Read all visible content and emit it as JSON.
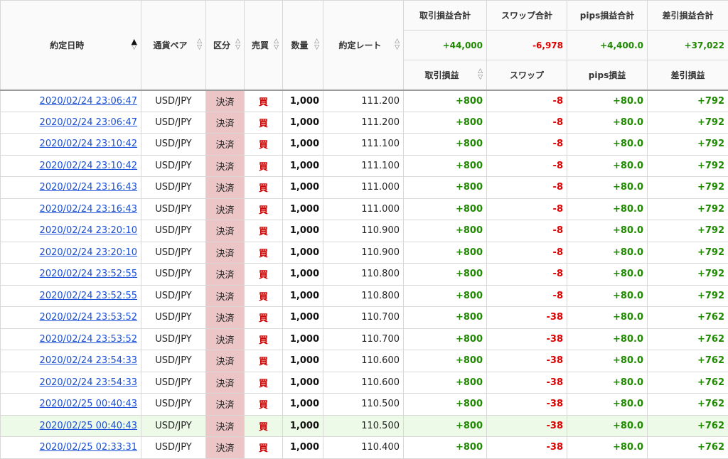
{
  "headers": {
    "datetime": "約定日時",
    "pair": "通貨ペア",
    "kind": "区分",
    "side": "売買",
    "qty": "数量",
    "rate": "約定レート",
    "pl_total": "取引損益合計",
    "swap_total": "スワップ合計",
    "pips_total": "pips損益合計",
    "net_total": "差引損益合計",
    "pl": "取引損益",
    "swap": "スワップ",
    "pips": "pips損益",
    "net": "差引損益"
  },
  "sort_glyphs": {
    "up": "△",
    "down": "▽",
    "up_active": "▲"
  },
  "totals": {
    "pl": "+44,000",
    "swap": "-6,978",
    "pips": "+4,400.0",
    "net": "+37,022"
  },
  "colors": {
    "positive": "#1f8a00",
    "negative": "#e00000",
    "kind_bg": "#ecc6c6",
    "highlight_row": "#eefae8",
    "link": "#1a4fd6"
  },
  "rows": [
    {
      "dt": "2020/02/24 23:06:47",
      "pair": "USD/JPY",
      "kind": "決済",
      "side": "買",
      "qty": "1,000",
      "rate": "111.200",
      "pl": "+800",
      "swap": "-8",
      "pips": "+80.0",
      "net": "+792"
    },
    {
      "dt": "2020/02/24 23:06:47",
      "pair": "USD/JPY",
      "kind": "決済",
      "side": "買",
      "qty": "1,000",
      "rate": "111.200",
      "pl": "+800",
      "swap": "-8",
      "pips": "+80.0",
      "net": "+792"
    },
    {
      "dt": "2020/02/24 23:10:42",
      "pair": "USD/JPY",
      "kind": "決済",
      "side": "買",
      "qty": "1,000",
      "rate": "111.100",
      "pl": "+800",
      "swap": "-8",
      "pips": "+80.0",
      "net": "+792"
    },
    {
      "dt": "2020/02/24 23:10:42",
      "pair": "USD/JPY",
      "kind": "決済",
      "side": "買",
      "qty": "1,000",
      "rate": "111.100",
      "pl": "+800",
      "swap": "-8",
      "pips": "+80.0",
      "net": "+792"
    },
    {
      "dt": "2020/02/24 23:16:43",
      "pair": "USD/JPY",
      "kind": "決済",
      "side": "買",
      "qty": "1,000",
      "rate": "111.000",
      "pl": "+800",
      "swap": "-8",
      "pips": "+80.0",
      "net": "+792"
    },
    {
      "dt": "2020/02/24 23:16:43",
      "pair": "USD/JPY",
      "kind": "決済",
      "side": "買",
      "qty": "1,000",
      "rate": "111.000",
      "pl": "+800",
      "swap": "-8",
      "pips": "+80.0",
      "net": "+792"
    },
    {
      "dt": "2020/02/24 23:20:10",
      "pair": "USD/JPY",
      "kind": "決済",
      "side": "買",
      "qty": "1,000",
      "rate": "110.900",
      "pl": "+800",
      "swap": "-8",
      "pips": "+80.0",
      "net": "+792"
    },
    {
      "dt": "2020/02/24 23:20:10",
      "pair": "USD/JPY",
      "kind": "決済",
      "side": "買",
      "qty": "1,000",
      "rate": "110.900",
      "pl": "+800",
      "swap": "-8",
      "pips": "+80.0",
      "net": "+792"
    },
    {
      "dt": "2020/02/24 23:52:55",
      "pair": "USD/JPY",
      "kind": "決済",
      "side": "買",
      "qty": "1,000",
      "rate": "110.800",
      "pl": "+800",
      "swap": "-8",
      "pips": "+80.0",
      "net": "+792"
    },
    {
      "dt": "2020/02/24 23:52:55",
      "pair": "USD/JPY",
      "kind": "決済",
      "side": "買",
      "qty": "1,000",
      "rate": "110.800",
      "pl": "+800",
      "swap": "-8",
      "pips": "+80.0",
      "net": "+792"
    },
    {
      "dt": "2020/02/24 23:53:52",
      "pair": "USD/JPY",
      "kind": "決済",
      "side": "買",
      "qty": "1,000",
      "rate": "110.700",
      "pl": "+800",
      "swap": "-38",
      "pips": "+80.0",
      "net": "+762"
    },
    {
      "dt": "2020/02/24 23:53:52",
      "pair": "USD/JPY",
      "kind": "決済",
      "side": "買",
      "qty": "1,000",
      "rate": "110.700",
      "pl": "+800",
      "swap": "-38",
      "pips": "+80.0",
      "net": "+762"
    },
    {
      "dt": "2020/02/24 23:54:33",
      "pair": "USD/JPY",
      "kind": "決済",
      "side": "買",
      "qty": "1,000",
      "rate": "110.600",
      "pl": "+800",
      "swap": "-38",
      "pips": "+80.0",
      "net": "+762"
    },
    {
      "dt": "2020/02/24 23:54:33",
      "pair": "USD/JPY",
      "kind": "決済",
      "side": "買",
      "qty": "1,000",
      "rate": "110.600",
      "pl": "+800",
      "swap": "-38",
      "pips": "+80.0",
      "net": "+762"
    },
    {
      "dt": "2020/02/25 00:40:43",
      "pair": "USD/JPY",
      "kind": "決済",
      "side": "買",
      "qty": "1,000",
      "rate": "110.500",
      "pl": "+800",
      "swap": "-38",
      "pips": "+80.0",
      "net": "+762"
    },
    {
      "dt": "2020/02/25 00:40:43",
      "pair": "USD/JPY",
      "kind": "決済",
      "side": "買",
      "qty": "1,000",
      "rate": "110.500",
      "pl": "+800",
      "swap": "-38",
      "pips": "+80.0",
      "net": "+762",
      "highlight": true
    },
    {
      "dt": "2020/02/25 02:33:31",
      "pair": "USD/JPY",
      "kind": "決済",
      "side": "買",
      "qty": "1,000",
      "rate": "110.400",
      "pl": "+800",
      "swap": "-38",
      "pips": "+80.0",
      "net": "+762"
    }
  ]
}
